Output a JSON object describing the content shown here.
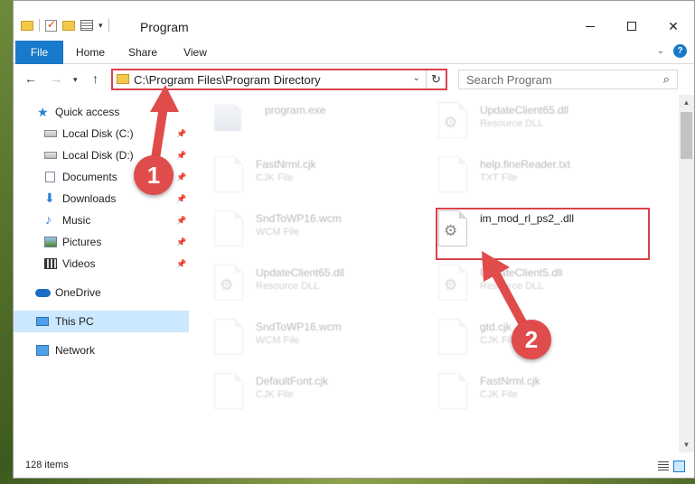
{
  "window": {
    "title": "Program",
    "tabs": [
      "File",
      "Home",
      "Share",
      "View"
    ],
    "controls": {
      "minimize": "—",
      "maximize": "☐",
      "close": "✕"
    }
  },
  "navigation": {
    "address": "C:\\Program Files\\Program Directory",
    "search_placeholder": "Search Program"
  },
  "sidebar": {
    "items": [
      {
        "label": "Quick access",
        "icon": "star-icon",
        "pinned": false
      },
      {
        "label": "Local Disk (C:)",
        "icon": "drive-icon",
        "pinned": true
      },
      {
        "label": "Local Disk (D:)",
        "icon": "drive-icon",
        "pinned": true
      },
      {
        "label": "Documents",
        "icon": "documents-icon",
        "pinned": true
      },
      {
        "label": "Downloads",
        "icon": "download-icon",
        "pinned": true
      },
      {
        "label": "Music",
        "icon": "music-icon",
        "pinned": true
      },
      {
        "label": "Pictures",
        "icon": "pictures-icon",
        "pinned": true
      },
      {
        "label": "Videos",
        "icon": "videos-icon",
        "pinned": true
      },
      {
        "label": "OneDrive",
        "icon": "cloud-icon",
        "pinned": false
      },
      {
        "label": "This PC",
        "icon": "computer-icon",
        "pinned": false
      },
      {
        "label": "Network",
        "icon": "network-icon",
        "pinned": false
      }
    ]
  },
  "files": [
    {
      "name": "program.exe",
      "type": ""
    },
    {
      "name": "UpdateClient65.dll",
      "type": "Resource DLL"
    },
    {
      "name": "FastNrml.cjk",
      "type": "CJK File"
    },
    {
      "name": "help.fineReader.txt",
      "type": "TXT File"
    },
    {
      "name": "SndToWP16.wcm",
      "type": "WCM File"
    },
    {
      "name": "im_mod_rl_ps2_.dll",
      "type": ""
    },
    {
      "name": "UpdateClient65.dll",
      "type": "Resource DLL"
    },
    {
      "name": "UpdateClient5.dll",
      "type": "Resource DLL"
    },
    {
      "name": "SndToWP16.wcm",
      "type": "WCM File"
    },
    {
      "name": "gtd.cjk",
      "type": "CJK File"
    },
    {
      "name": "DefaultFont.cjk",
      "type": "CJK File"
    },
    {
      "name": "FastNrml.cjk",
      "type": "CJK File"
    }
  ],
  "status": {
    "item_count": "128 items"
  },
  "annotations": {
    "step1": "1",
    "step2": "2"
  },
  "colors": {
    "accent": "#1979ca",
    "highlight": "#d9424a",
    "selected": "#cce8ff"
  }
}
